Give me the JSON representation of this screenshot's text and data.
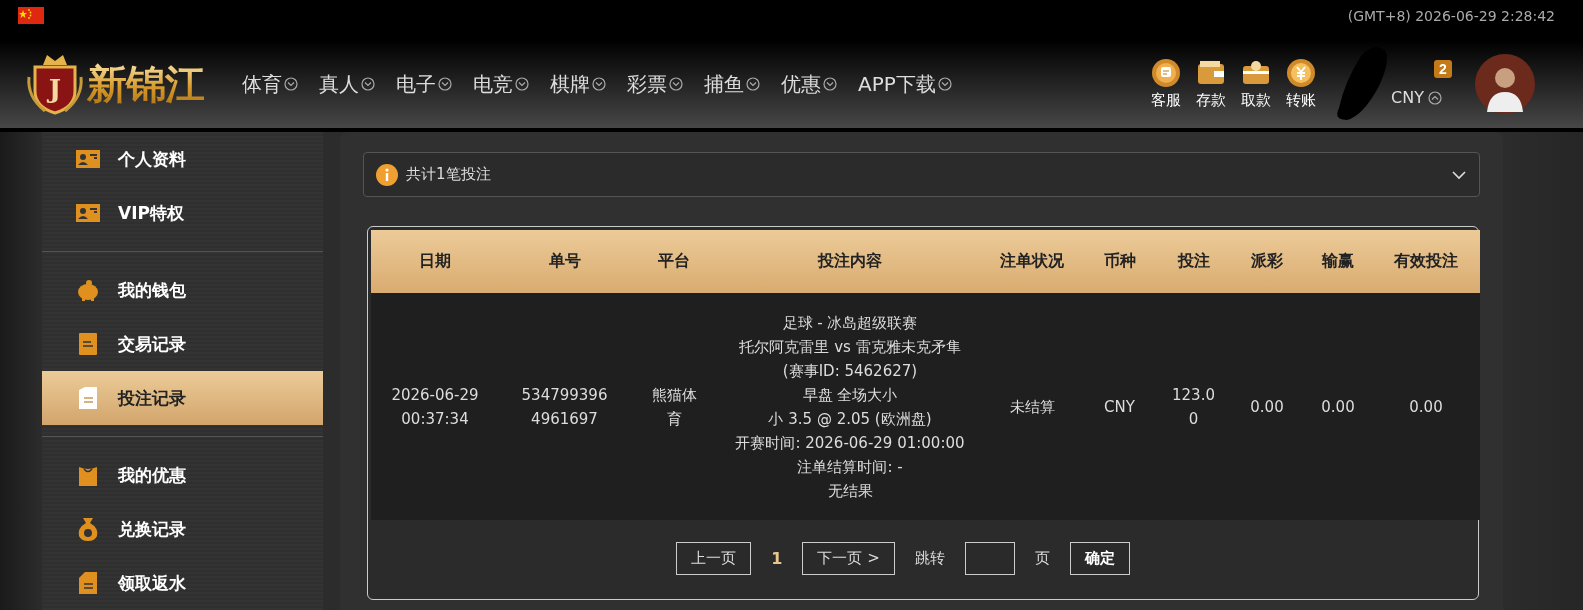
{
  "top_bar": {
    "time": "(GMT+8) 2026-06-29 2:28:42"
  },
  "header": {
    "logo": {
      "emblem": "J",
      "name": "新锦江"
    },
    "nav": [
      {
        "label": "体育"
      },
      {
        "label": "真人"
      },
      {
        "label": "电子"
      },
      {
        "label": "电竞"
      },
      {
        "label": "棋牌"
      },
      {
        "label": "彩票"
      },
      {
        "label": "捕鱼"
      },
      {
        "label": "优惠"
      },
      {
        "label": "APP下载"
      }
    ],
    "quick_links": [
      {
        "label": "客服"
      },
      {
        "label": "存款"
      },
      {
        "label": "取款"
      },
      {
        "label": "转账"
      }
    ],
    "account": {
      "badge": "2",
      "currency": "CNY"
    }
  },
  "sidebar": {
    "groups": [
      {
        "items": [
          {
            "label": "个人资料",
            "selected": false
          },
          {
            "label": "VIP特权",
            "selected": false
          }
        ]
      },
      {
        "items": [
          {
            "label": "我的钱包",
            "selected": false
          },
          {
            "label": "交易记录",
            "selected": false
          },
          {
            "label": "投注记录",
            "selected": true
          }
        ]
      },
      {
        "items": [
          {
            "label": "我的优惠",
            "selected": false
          },
          {
            "label": "兑换记录",
            "selected": false
          },
          {
            "label": "领取返水",
            "selected": false
          }
        ]
      }
    ]
  },
  "summary": {
    "text": "共计1笔投注",
    "expanded": false
  },
  "table": {
    "columns": [
      "日期",
      "单号",
      "平台",
      "投注内容",
      "注单状况",
      "币种",
      "投注",
      "派彩",
      "输赢",
      "有效投注"
    ],
    "rows": [
      {
        "date": "2026-06-29 00:37:34",
        "order_no": "5347993964961697",
        "platform": "熊猫体育",
        "details": [
          "足球 - 冰岛超级联赛",
          "托尔阿克雷里 vs 雷克雅未克矛隼 (赛事ID: 5462627)",
          "早盘 全场大小",
          "小 3.5 @ 2.05 (欧洲盘)",
          "开赛时间: 2026-06-29 01:00:00",
          "注单结算时间: -",
          "无结果"
        ],
        "status": "未结算",
        "currency": "CNY",
        "stake": "123.00",
        "payout": "0.00",
        "win_loss": "0.00",
        "valid_bet": "0.00"
      }
    ]
  },
  "pagination": {
    "prev": "上一页",
    "current": "1",
    "next": "下一页 >",
    "jump_label": "跳转",
    "page_suffix": "页",
    "confirm": "确定"
  }
}
